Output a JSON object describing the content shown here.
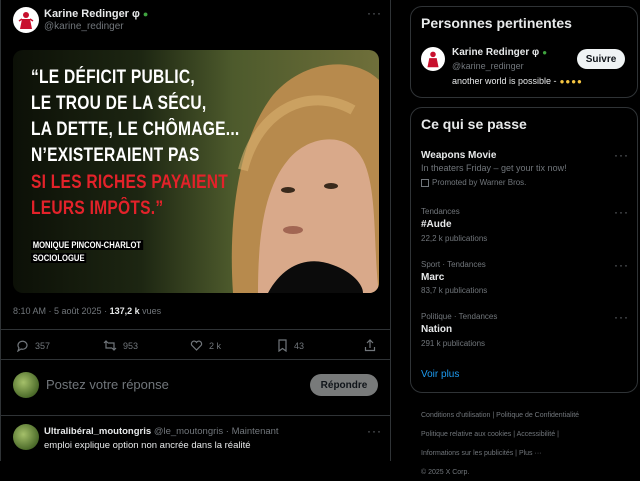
{
  "tweet": {
    "author_name": "Karine Redinger φ",
    "author_handle": "@karine_redinger",
    "quote_lines": [
      "“LE DÉFICIT PUBLIC,",
      "LE TROU DE LA SÉCU,",
      "LA DETTE, LE CHÔMAGE...",
      "N’EXISTERAIENT PAS",
      "SI LES RICHES PAYAIENT",
      "LEURS IMPÔTS.”"
    ],
    "quote_attribution_name": "MONIQUE PINCON-CHARLOT",
    "quote_attribution_role": "SOCIOLOGUE",
    "time": "8:10 AM · 5 août 2025 ·",
    "views_count": "137,2 k",
    "views_label": "vues",
    "replies": "357",
    "reposts": "953",
    "likes": "2 k",
    "bookmarks": "43"
  },
  "reply_composer": {
    "placeholder": "Postez votre réponse",
    "button": "Répondre"
  },
  "reply": {
    "author_name": "Ultralibéral_moutongris",
    "author_handle": "@le_moutongris · Maintenant",
    "text": "emploi explique option non ancrée dans la réalité"
  },
  "relevant_people": {
    "title": "Personnes pertinentes",
    "name": "Karine Redinger φ",
    "handle": "@karine_redinger",
    "bio": "another world is possible -",
    "follow_label": "Suivre"
  },
  "trends": {
    "title": "Ce qui se passe",
    "items": [
      {
        "meta": "",
        "name": "Weapons Movie",
        "sub": "In theaters Friday – get your tix now!",
        "promo": "Promoted by Warner Bros."
      },
      {
        "meta": "Tendances",
        "name": "#Aude",
        "count": "22,2 k publications"
      },
      {
        "meta": "Sport · Tendances",
        "name": "Marc",
        "count": "83,7 k publications"
      },
      {
        "meta": "Politique · Tendances",
        "name": "Nation",
        "count": "291 k publications"
      }
    ],
    "show_more": "Voir plus"
  },
  "footer": {
    "links": [
      "Conditions d'utilisation",
      "Politique de Confidentialité",
      "Politique relative aux cookies",
      "Accessibilité",
      "Informations sur les publicités",
      "Plus ···"
    ],
    "copyright": "© 2025 X Corp."
  },
  "colors": {
    "accent": "#1d9bf0",
    "quote_red": "#e3222a",
    "border": "#2f3336"
  }
}
